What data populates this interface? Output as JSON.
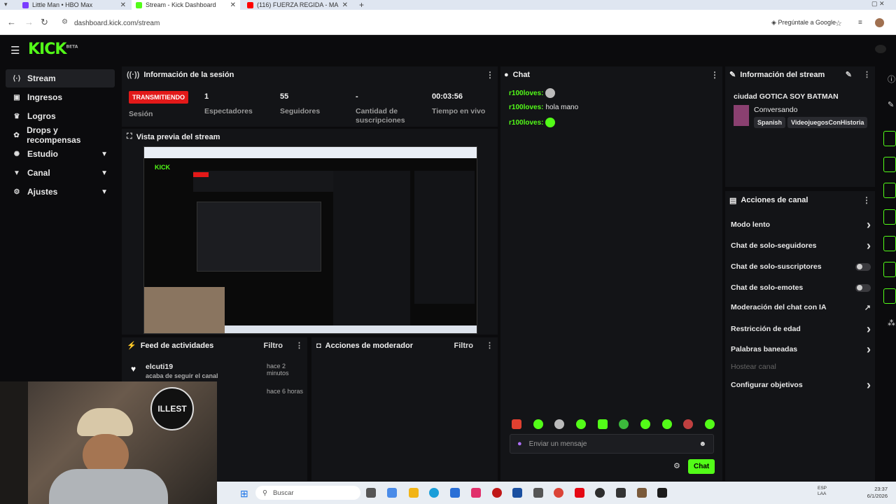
{
  "browser": {
    "tabs": [
      {
        "label": "Little Man • HBO Max",
        "color": "#7a3cff"
      },
      {
        "label": "Stream - Kick Dashboard",
        "color": "#53fc18"
      },
      {
        "label": "(116) FUERZA REGIDA - MA",
        "color": "#ff0000"
      }
    ],
    "url": "dashboard.kick.com/stream",
    "ask_google": "Pregúntale a Google"
  },
  "app": {
    "logo": "KICK",
    "logo_badge": "BETA"
  },
  "sidebar": {
    "items": [
      {
        "label": "Stream",
        "icon": "stream-icon",
        "glyph": "⟨·⟩",
        "selected": true
      },
      {
        "label": "Ingresos",
        "icon": "money-icon",
        "glyph": "▣"
      },
      {
        "label": "Logros",
        "icon": "trophy-icon",
        "glyph": "♛"
      },
      {
        "label": "Drops y recompensas",
        "icon": "gift-icon",
        "glyph": "✿"
      },
      {
        "label": "Estudio",
        "icon": "studio-icon",
        "glyph": "✺",
        "expandable": true
      },
      {
        "label": "Canal",
        "icon": "channel-icon",
        "glyph": "▼",
        "expandable": true
      },
      {
        "label": "Ajustes",
        "icon": "settings-icon",
        "glyph": "⚙",
        "expandable": true
      }
    ]
  },
  "session": {
    "title": "Información de la sesión",
    "status": "TRANSMITIENDO",
    "status_label": "Sesión",
    "stats": [
      {
        "value": "1",
        "label": "Espectadores"
      },
      {
        "value": "55",
        "label": "Seguidores"
      },
      {
        "value": "-",
        "label": "Cantidad de suscripciones"
      },
      {
        "value": "00:03:56",
        "label": "Tiempo en vivo"
      }
    ]
  },
  "preview": {
    "title": "Vista previa del stream"
  },
  "activity": {
    "title": "Feed de actividades",
    "filter": "Filtro",
    "items": [
      {
        "user": "elcuti19",
        "action": "acaba de seguir el canal",
        "time": "hace 2 minutos"
      },
      {
        "user": "",
        "action": "",
        "time": "hace 6 horas"
      }
    ]
  },
  "moderator": {
    "title": "Acciones de moderador",
    "filter": "Filtro"
  },
  "chat": {
    "title": "Chat",
    "messages": [
      {
        "user": "r100loves:",
        "text": ""
      },
      {
        "user": "r100loves:",
        "text": "hola mano"
      },
      {
        "user": "r100loves:",
        "text": ""
      }
    ],
    "placeholder": "Enviar un mensaje",
    "send": "Chat"
  },
  "stream_info": {
    "title": "Información del stream",
    "stream_title": "ciudad GOTICA SOY BATMAN",
    "category": "Conversando",
    "tags": [
      "Spanish",
      "VideojuegosConHistoria"
    ]
  },
  "channel_actions": {
    "title": "Acciones de canal",
    "items": [
      {
        "label": "Modo lento",
        "control": "arrow"
      },
      {
        "label": "Chat de solo-seguidores",
        "control": "arrow"
      },
      {
        "label": "Chat de solo-suscriptores",
        "control": "toggle"
      },
      {
        "label": "Chat de solo-emotes",
        "control": "toggle"
      },
      {
        "label": "Moderación del chat con IA",
        "control": "external"
      },
      {
        "label": "Restricción de edad",
        "control": "arrow"
      },
      {
        "label": "Palabras baneadas",
        "control": "arrow"
      },
      {
        "label": "Hostear canal",
        "control": "disabled"
      },
      {
        "label": "Configurar objetivos",
        "control": "arrow"
      }
    ]
  },
  "webcam": {
    "logo_text": "ILLEST"
  },
  "taskbar": {
    "search": "Buscar",
    "lang": "ESP LAA",
    "time": "23:37",
    "date": "6/1/2026"
  }
}
